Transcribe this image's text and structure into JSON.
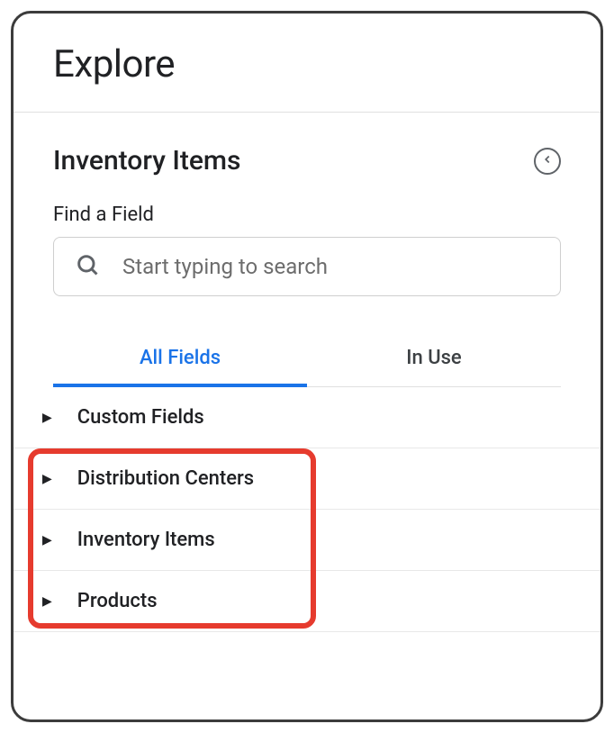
{
  "header": {
    "title": "Explore"
  },
  "panel": {
    "title": "Inventory Items",
    "search_label": "Find a Field",
    "search_placeholder": "Start typing to search"
  },
  "tabs": {
    "all": "All Fields",
    "inuse": "In Use"
  },
  "fields": [
    {
      "label": "Custom Fields"
    },
    {
      "label": "Distribution Centers"
    },
    {
      "label": "Inventory Items"
    },
    {
      "label": "Products"
    }
  ]
}
